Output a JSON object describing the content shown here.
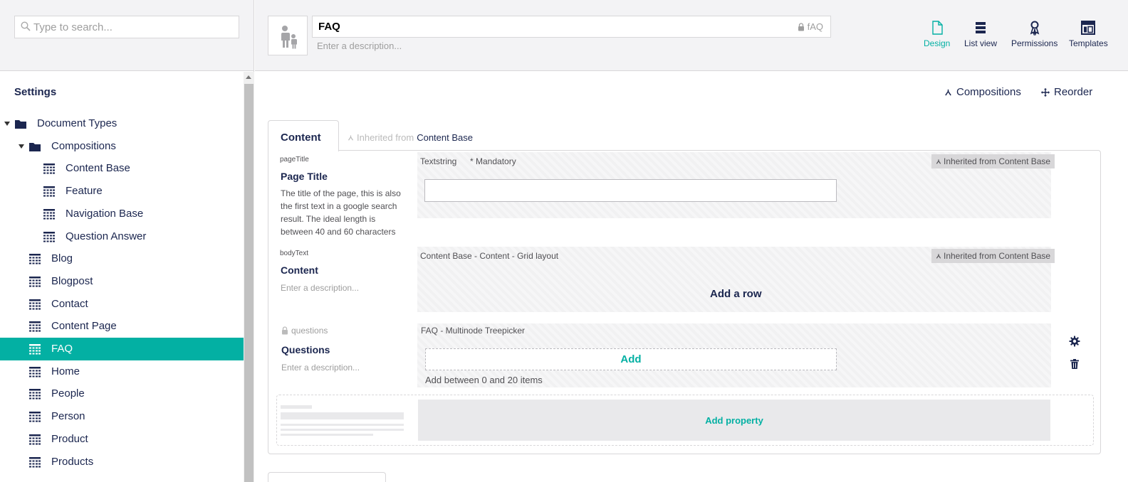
{
  "sidebar": {
    "search_placeholder": "Type to search...",
    "section_title": "Settings",
    "tree": [
      {
        "label": "Document Types",
        "level": 0,
        "type": "folder",
        "expanded": true
      },
      {
        "label": "Compositions",
        "level": 1,
        "type": "folder",
        "expanded": true
      },
      {
        "label": "Content Base",
        "level": 2,
        "type": "doctype"
      },
      {
        "label": "Feature",
        "level": 2,
        "type": "doctype"
      },
      {
        "label": "Navigation Base",
        "level": 2,
        "type": "doctype"
      },
      {
        "label": "Question Answer",
        "level": 2,
        "type": "doctype"
      },
      {
        "label": "Blog",
        "level": 1,
        "type": "doctype"
      },
      {
        "label": "Blogpost",
        "level": 1,
        "type": "doctype"
      },
      {
        "label": "Contact",
        "level": 1,
        "type": "doctype"
      },
      {
        "label": "Content Page",
        "level": 1,
        "type": "doctype"
      },
      {
        "label": "FAQ",
        "level": 1,
        "type": "doctype",
        "selected": true
      },
      {
        "label": "Home",
        "level": 1,
        "type": "doctype"
      },
      {
        "label": "People",
        "level": 1,
        "type": "doctype"
      },
      {
        "label": "Person",
        "level": 1,
        "type": "doctype"
      },
      {
        "label": "Product",
        "level": 1,
        "type": "doctype"
      },
      {
        "label": "Products",
        "level": 1,
        "type": "doctype"
      }
    ]
  },
  "header": {
    "name": "FAQ",
    "alias": "fAQ",
    "description_placeholder": "Enter a description...",
    "app_tabs": [
      {
        "label": "Design",
        "icon": "document-icon",
        "active": true
      },
      {
        "label": "List view",
        "icon": "list-icon"
      },
      {
        "label": "Permissions",
        "icon": "permissions-icon"
      },
      {
        "label": "Templates",
        "icon": "templates-icon"
      }
    ]
  },
  "toolbar": {
    "compositions_label": "Compositions",
    "reorder_label": "Reorder"
  },
  "tabs": {
    "active_label": "Content",
    "inherited_prefix": "Inherited from",
    "inherited_source": "Content Base"
  },
  "properties": [
    {
      "alias": "pageTitle",
      "label": "Page Title",
      "description": "The title of the page, this is also the first text in a google search result. The ideal length is between 40 and 60 characters",
      "editor": "Textstring",
      "mandatory": "* Mandatory",
      "inherited_badge": "Inherited from Content Base"
    },
    {
      "alias": "bodyText",
      "label": "Content",
      "description": "Enter a description...",
      "editor": "Content Base - Content - Grid layout",
      "inherited_badge": "Inherited from Content Base",
      "add_row_label": "Add a row"
    },
    {
      "alias": "questions",
      "label": "Questions",
      "description": "Enter a description...",
      "editor": "FAQ - Multinode Treepicker",
      "add_label": "Add",
      "hint": "Add between 0 and 20 items"
    }
  ],
  "add_property_label": "Add property",
  "colors": {
    "accent": "#03b0a3",
    "text": "#1b264f",
    "border": "#d8d7d9",
    "header_bg": "#f3f3f5"
  }
}
